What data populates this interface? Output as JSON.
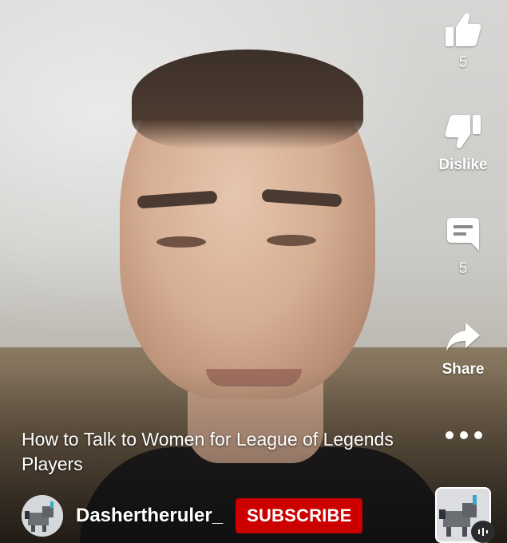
{
  "video": {
    "title": "How to Talk to Women for League of Legends Players"
  },
  "actions": {
    "like_count": "5",
    "dislike_label": "Dislike",
    "comment_count": "5",
    "share_label": "Share"
  },
  "channel": {
    "name": "Dashertheruler_",
    "subscribe_label": "SUBSCRIBE"
  },
  "colors": {
    "subscribe_bg": "#cc0000",
    "icon": "#ffffff"
  },
  "icons": [
    "thumbs-up-icon",
    "thumbs-down-icon",
    "comment-icon",
    "share-arrow-icon",
    "more-options-icon"
  ]
}
